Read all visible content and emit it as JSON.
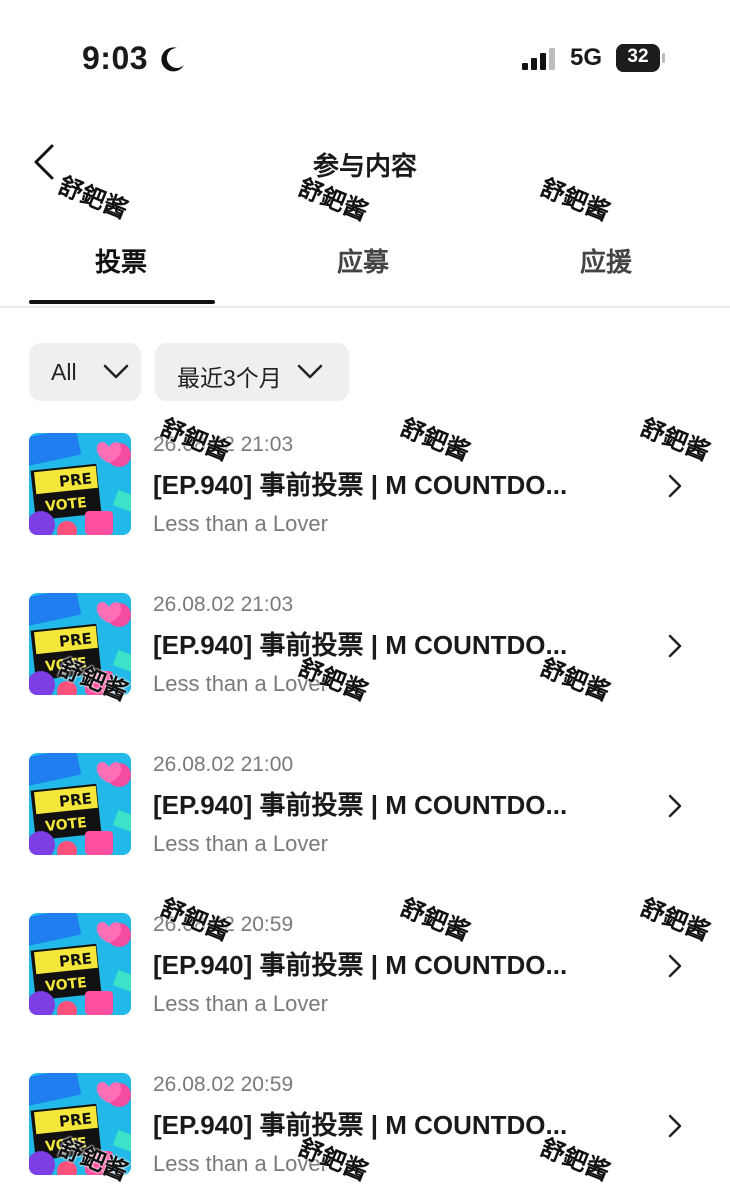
{
  "status_bar": {
    "time": "9:03",
    "network": "5G",
    "battery": "32",
    "icons": [
      "moon-icon",
      "signal-icon",
      "battery-icon"
    ]
  },
  "header": {
    "title": "参与内容",
    "back_icon": "chevron-left-icon"
  },
  "tabs": [
    {
      "label": "投票",
      "active": true
    },
    {
      "label": "应募",
      "active": false
    },
    {
      "label": "应援",
      "active": false
    }
  ],
  "filters": [
    {
      "label": "All",
      "icon": "chevron-down-icon"
    },
    {
      "label": "最近3个月",
      "icon": "chevron-down-icon"
    }
  ],
  "thumbnail": {
    "line1": "PRE",
    "line2": "VOTE"
  },
  "items": [
    {
      "date": "26.08.02 21:03",
      "title": "[EP.940] 事前投票 | M COUNTDO...",
      "subtitle": "Less than a Lover"
    },
    {
      "date": "26.08.02 21:03",
      "title": "[EP.940] 事前投票 | M COUNTDO...",
      "subtitle": "Less than a Lover"
    },
    {
      "date": "26.08.02 21:00",
      "title": "[EP.940] 事前投票 | M COUNTDO...",
      "subtitle": "Less than a Lover"
    },
    {
      "date": "26.08.02 20:59",
      "title": "[EP.940] 事前投票 | M COUNTDO...",
      "subtitle": "Less than a Lover"
    },
    {
      "date": "26.08.02 20:59",
      "title": "[EP.940] 事前投票 | M COUNTDO...",
      "subtitle": "Less than a Lover"
    }
  ],
  "watermark": "舒鈀酱",
  "colors": {
    "text": "#1a1a1a",
    "secondary": "#7a7a7a",
    "filter_bg": "#efefef",
    "thumb_bg": "#22b8e8",
    "thumb_banner": "#f5e63a"
  }
}
